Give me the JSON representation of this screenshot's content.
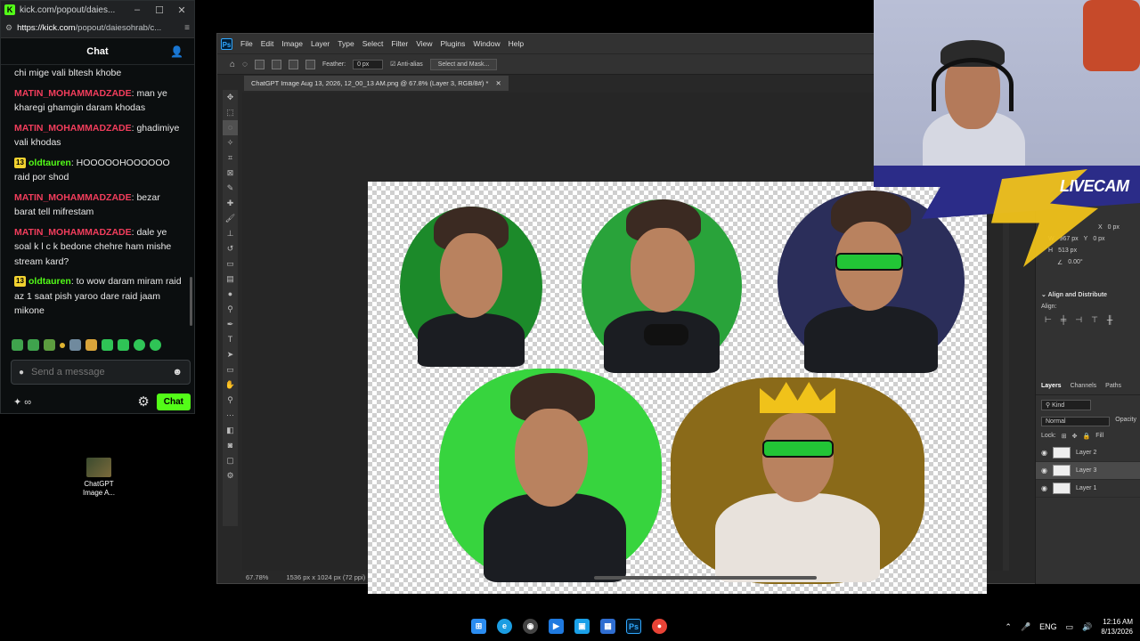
{
  "chat_window": {
    "title": "kick.com/popout/daies...",
    "url_host": "https://kick.com",
    "url_rest": "/popout/daiesohrab/c...",
    "header": "Chat",
    "messages": [
      {
        "user": "",
        "text": "chi mige vali bltesh khobe",
        "badge": "",
        "color": "red"
      },
      {
        "user": "MATIN_MOHAMMADZADE",
        "text": ": man ye kharegi ghamgin daram khodas",
        "badge": "",
        "color": "red"
      },
      {
        "user": "MATIN_MOHAMMADZADE",
        "text": ": ghadimiye vali khodas",
        "badge": "",
        "color": "red"
      },
      {
        "user": "oldtauren",
        "text": ": HOOOOOHOOOOOO raid por shod",
        "badge": "13",
        "color": "green"
      },
      {
        "user": "MATIN_MOHAMMADZADE",
        "text": ": bezar barat tell mifrestam",
        "badge": "",
        "color": "red"
      },
      {
        "user": "MATIN_MOHAMMADZADE",
        "text": ": dale ye soal k l c k bedone chehre ham mishe stream kard?",
        "badge": "",
        "color": "red"
      },
      {
        "user": "oldtauren",
        "text": ": to wow daram miram raid az 1 saat pish yaroo dare raid jaam mikone",
        "badge": "13",
        "color": "green"
      }
    ],
    "input_placeholder": "Send a message",
    "points": "∞",
    "chat_button": "Chat"
  },
  "desktop_icon": {
    "label": "ChatGPT Image A..."
  },
  "photoshop": {
    "menu": [
      "File",
      "Edit",
      "Image",
      "Layer",
      "Type",
      "Select",
      "Filter",
      "View",
      "Plugins",
      "Window",
      "Help"
    ],
    "options": {
      "feather_label": "Feather:",
      "feather_value": "0 px",
      "anti_alias": "Anti-alias",
      "select_mask": "Select and Mask..."
    },
    "doc_tab": "ChatGPT Image Aug 13, 2026, 12_00_13 AM.png @ 67.8% (Layer 3, RGB/8#) *",
    "zoom": "67.78%",
    "doc_size": "1536 px x 1024 px (72 ppi)",
    "properties": {
      "w": "967 px",
      "h": "513 px",
      "x": "0 px",
      "y": "0 px",
      "angle": "0.00°"
    },
    "align_title": "Align and Distribute",
    "align_label": "Align:",
    "layer_tabs": [
      "Layers",
      "Channels",
      "Paths"
    ],
    "kind": "Kind",
    "blend_mode": "Normal",
    "opacity_label": "Opacity",
    "lock_label": "Lock:",
    "fill_label": "Fill",
    "layers": [
      "Layer 2",
      "Layer 3",
      "Layer 1"
    ],
    "selected_layer": "Layer 3"
  },
  "webcam": {
    "label": "LIVECAM"
  },
  "taskbar": {
    "tray_lang": "ENG",
    "time": "12:16 AM",
    "date": "8/13/2026"
  }
}
